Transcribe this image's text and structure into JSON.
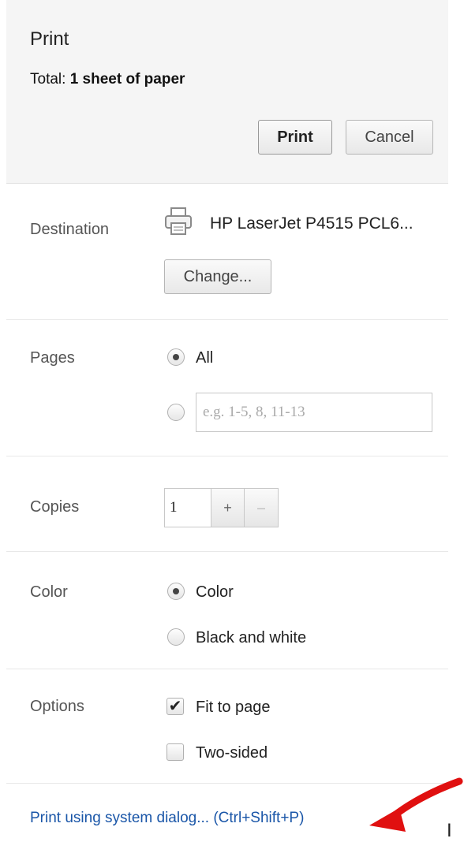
{
  "header": {
    "title": "Print",
    "total_label": "Total:",
    "total_value": "1 sheet of paper",
    "print_button": "Print",
    "cancel_button": "Cancel"
  },
  "destination": {
    "label": "Destination",
    "printer_icon": "printer-icon",
    "printer_name": "HP LaserJet P4515 PCL6...",
    "change_button": "Change..."
  },
  "pages": {
    "label": "Pages",
    "all_option": "All",
    "all_selected": true,
    "range_placeholder": "e.g. 1-5, 8, 11-13",
    "range_value": ""
  },
  "copies": {
    "label": "Copies",
    "value": "1",
    "increment": "+",
    "decrement": "–"
  },
  "color": {
    "label": "Color",
    "options": [
      "Color",
      "Black and white"
    ],
    "selected": "Color"
  },
  "options": {
    "label": "Options",
    "fit_to_page": "Fit to page",
    "fit_to_page_checked": true,
    "two_sided": "Two-sided",
    "two_sided_checked": false
  },
  "footer": {
    "system_dialog_link": "Print using system dialog... (Ctrl+Shift+P)",
    "edge_text": "I"
  },
  "colors": {
    "link": "#1a56a8",
    "annotation_arrow": "#e01010"
  }
}
